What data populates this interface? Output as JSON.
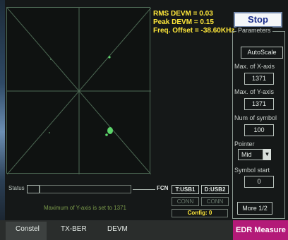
{
  "readouts": {
    "rms_devm": "RMS DEVM = 0.03",
    "peak_devm": "Peak DEVM = 0.15",
    "freq_offset": "Freq. Offset = -38.60KHz"
  },
  "stop_label": "Stop",
  "parameters": {
    "title": "Parameters",
    "autoscale_label": "AutoScale",
    "max_x_label": "Max. of X-axis",
    "max_x_value": "1371",
    "max_y_label": "Max. of Y-axis",
    "max_y_value": "1371",
    "num_symbol_label": "Num of symbol",
    "num_symbol_value": "100",
    "pointer_label": "Pointer",
    "pointer_value": "Mid",
    "symbol_start_label": "Symbol start",
    "symbol_start_value": "0",
    "more_label": "More 1/2"
  },
  "status": {
    "label": "Status",
    "message": "Maximum of Y-axis is set to 1371"
  },
  "connections": {
    "fcn_label": "FCN",
    "t_usb_label": "T:USB1",
    "d_usb_label": "D:USB2",
    "t_state": "CONN",
    "d_state": "CONN",
    "config": "Config: 0"
  },
  "tabs": [
    "Constel",
    "TX-BER",
    "DEVM"
  ],
  "edr_label": "EDR Measure",
  "colors": {
    "readout": "#ffe83a",
    "accent_magenta": "#b31a78",
    "plot_grid": "#4e6a55",
    "points": "#5bd46a"
  }
}
